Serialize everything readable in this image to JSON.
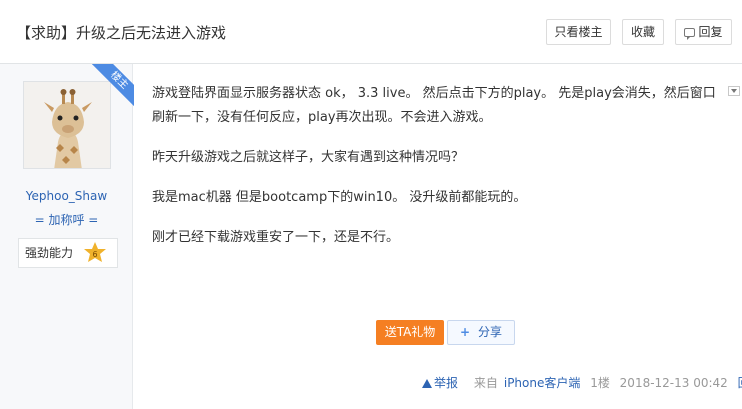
{
  "post": {
    "title": "【求助】升级之后无法进入游戏",
    "buttons": {
      "only_op": "只看楼主",
      "favorite": "收藏",
      "reply": "回复"
    }
  },
  "author": {
    "name": "Yephoo_Shaw",
    "add_friend": "= 加称呼 =",
    "ribbon": "楼主",
    "badge_label": "强劲能力",
    "badge_level": "6"
  },
  "content": {
    "paragraphs": [
      "游戏登陆界面显示服务器状态 ok， 3.3 live。 然后点击下方的play。 先是play会消失，然后窗口刷新一下，没有任何反应，play再次出现。不会进入游戏。",
      "昨天升级游戏之后就这样子，大家有遇到这种情况吗？",
      "我是mac机器 但是bootcamp下的win10。 没升级前都能玩的。",
      "刚才已经下载游戏重安了一下，还是不行。"
    ]
  },
  "actions": {
    "gift": "送TA礼物",
    "share": "分享"
  },
  "meta": {
    "report": "举报",
    "source_prefix": "来自",
    "source_client": "iPhone客户端",
    "floor": "1楼",
    "time": "2018-12-13 00:42",
    "reply": "回复"
  },
  "colors": {
    "accent_blue": "#2d64b3",
    "ribbon_blue": "#4d8be3",
    "gift_orange": "#f57f22",
    "badge_gold": "#f0b22c"
  },
  "icons": {
    "more": "dropdown-arrow-icon",
    "reply": "speech-bubble-icon",
    "report": "warning-icon",
    "level": "star-badge-icon"
  }
}
